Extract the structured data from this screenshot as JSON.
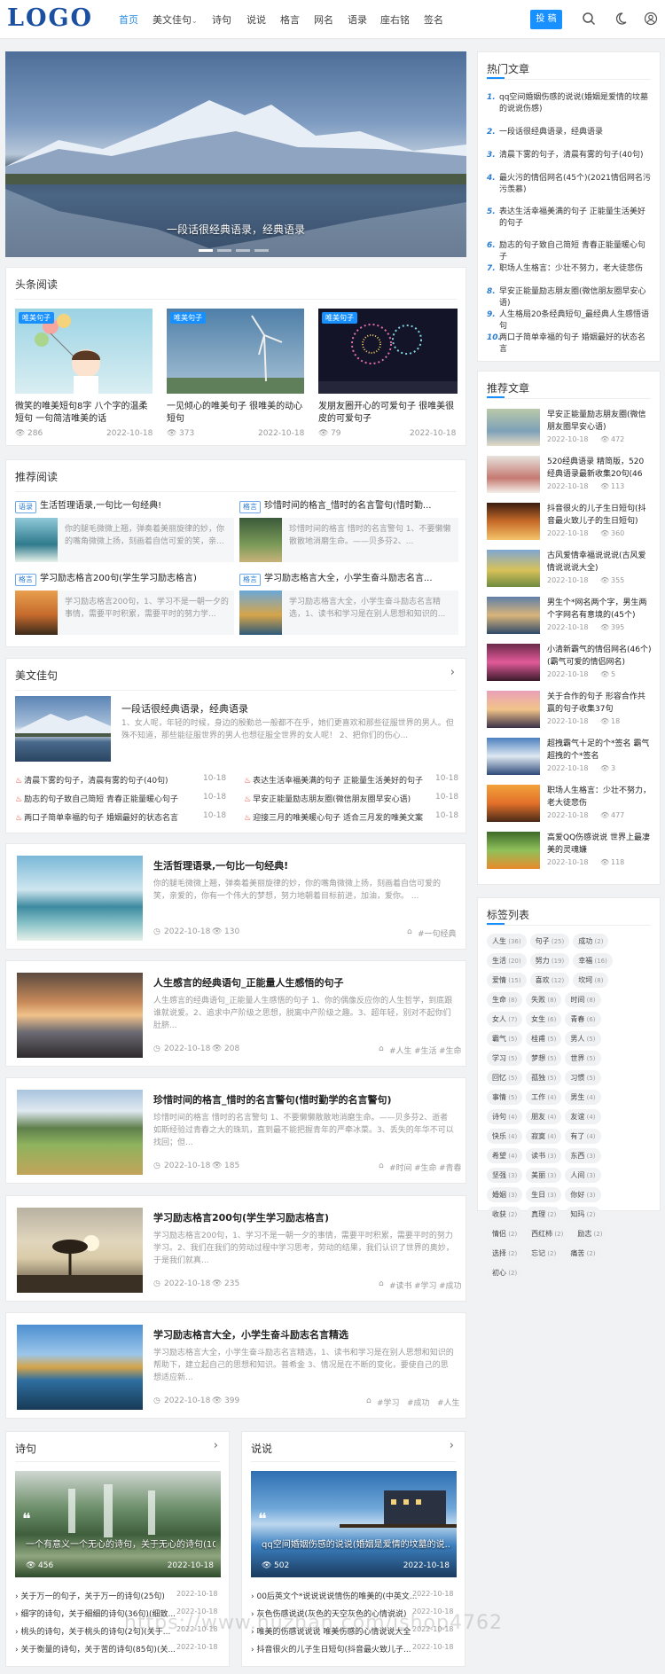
{
  "header": {
    "logo": "LOGO",
    "nav": [
      {
        "label": "首页",
        "active": true
      },
      {
        "label": "美文佳句",
        "dropdown": true
      },
      {
        "label": "诗句"
      },
      {
        "label": "说说"
      },
      {
        "label": "格言"
      },
      {
        "label": "网名"
      },
      {
        "label": "语录"
      },
      {
        "label": "座右铭"
      },
      {
        "label": "签名"
      }
    ],
    "post_button": "投 稿",
    "icons": [
      "search-icon",
      "moon-icon",
      "user-icon"
    ],
    "accent": "#1890ff"
  },
  "hero": {
    "caption": "一段话很经典语录，经典语录",
    "slides": 4,
    "active_slide": 1
  },
  "headline": {
    "title": "头条阅读",
    "items": [
      {
        "badge": "唯美句子",
        "title": "微笑的唯美短句8字 八个字的温柔短句 一句简洁唯美的话",
        "views": "286",
        "date": "2022-10-18"
      },
      {
        "badge": "唯美句子",
        "title": "一见倾心的唯美句子 很唯美的动心短句",
        "views": "373",
        "date": "2022-10-18"
      },
      {
        "badge": "唯美句子",
        "title": "发朋友圈开心的可爱句子 很唯美很皮的可爱句子",
        "views": "79",
        "date": "2022-10-18"
      }
    ]
  },
  "recommended_read": {
    "title": "推荐阅读",
    "items": [
      {
        "tag": "语录",
        "title": "生活哲理语录,一句比一句经典!",
        "excerpt": "你的腿毛微微上翘，弹奏着美丽旋律的妙，你的嘴角微微上扬，刻画着自信可爱的笑，亲..."
      },
      {
        "tag": "格言",
        "title": "珍惜时间的格言_惜时的名言警句(惜时勤...",
        "excerpt": "珍惜时间的格言 惜时的名言警句 1、不要懒懒散散地消磨生命。——贝多芬2、..."
      },
      {
        "tag": "格言",
        "title": "学习励志格言200句(学生学习励志格言)",
        "excerpt": "学习励志格言200句，1、学习不是一朝一夕的事情，需要平时积累，需要平时的努力学..."
      },
      {
        "tag": "格言",
        "title": "学习励志格言大全，小学生奋斗励志名言...",
        "excerpt": "学习励志格言大全，小学生奋斗励志名言精选，1、读书和学习是在别人思想和知识的..."
      }
    ]
  },
  "beautiful": {
    "title": "美文佳句",
    "feature_title": "一段话很经典语录，经典语录",
    "feature_excerpt": "1、女人呢，年轻的时候，身边的殷勤总一般都不在乎，她们更喜欢和那些征服世界的男人。但殊不知道，那些能征服世界的男人也想征服全世界的女人呢！ 2、把你们的伤心...",
    "list_left": [
      {
        "title": "清晨下雾的句子，清晨有雾的句子(40句)",
        "date": "10-18"
      },
      {
        "title": "励志的句子致自己简短 青春正能量暖心句子",
        "date": "10-18"
      },
      {
        "title": "两口子简单幸福的句子 婚姻最好的状态名言",
        "date": "10-18"
      }
    ],
    "list_right": [
      {
        "title": "表达生活幸福美满的句子 正能量生活美好的句子",
        "date": "10-18"
      },
      {
        "title": "早安正能量励志朋友圈(微信朋友圈早安心语)",
        "date": "10-18"
      },
      {
        "title": "迎接三月的唯美暖心句子 适合三月发的唯美文案",
        "date": "10-18"
      }
    ]
  },
  "articles": [
    {
      "title": "生活哲理语录,一句比一句经典!",
      "excerpt": "你的腿毛微微上翘，弹奏着美丽旋律的妙，你的嘴角微微上扬，刻画着自信可爱的笑，亲爱的，你有一个伟大的梦想，努力地朝着目标前进，加油，爱你。 ...",
      "date": "2022-10-18",
      "views": "130",
      "tags": [
        "一句经典"
      ]
    },
    {
      "title": "人生感言的经典语句_正能量人生感悟的句子",
      "excerpt": "人生感言的经典语句_正能量人生感悟的句子 1、你的偶像反应你的人生哲学，到底跟谁就说爱。2、追求中产阶级之思想，脱离中产阶级之趣。3、超年轻，别对不起你们肚脐...",
      "date": "2022-10-18",
      "views": "208",
      "tags": [
        "人生",
        "生活",
        "生命"
      ]
    },
    {
      "title": "珍惜时间的格言_惜时的名言警句(惜时勤学的名言警句)",
      "excerpt": "珍惜时间的格言 惜时的名言警句 1、不要懒懒散散地消磨生命。——贝多芬2、逝者如斯经验过青春之大的珠玑，直到最不能把握青年的严牵冰菜。3、丢失的年华不可以找回；但...",
      "date": "2022-10-18",
      "views": "185",
      "tags": [
        "时间",
        "生命",
        "青春"
      ]
    },
    {
      "title": "学习励志格言200句(学生学习励志格言)",
      "excerpt": "学习励志格言200句，1、学习不是一朝一夕的事情，需要平时积累，需要平时的努力学习。2、我们在我们的劳动过程中学习思考，劳动的结果，我们认识了世界的奥妙，于是我们就真...",
      "date": "2022-10-18",
      "views": "235",
      "tags": [
        "读书",
        "学习",
        "成功"
      ]
    },
    {
      "title": "学习励志格言大全，小学生奋斗励志名言精选",
      "excerpt": "学习励志格言大全，小学生奋斗励志名言精选，1、读书和学习是在别人思想和知识的帮助下，建立起自己的思想和知识。普希金 3、情况是在不断的变化，要使自己的思想适应新...",
      "date": "2022-10-18",
      "views": "399",
      "tags": [
        "学习",
        "成功",
        "人生"
      ]
    }
  ],
  "poetry": {
    "title": "诗句",
    "feature_title": "一个有意义一个无心的诗句，关于无心的诗句(10...",
    "views": "456",
    "date": "2022-10-18",
    "list": [
      {
        "title": "关于万一的句子，关于万一的诗句(25句)",
        "date": "2022-10-18"
      },
      {
        "title": "细字的诗句，关于细细的诗句(36句)(细致...",
        "date": "2022-10-18"
      },
      {
        "title": "桃头的诗句，关于桃头的诗句(2句)(关于...",
        "date": "2022-10-18"
      },
      {
        "title": "关于衡量的诗句，关于苦的诗句(85句)(关...",
        "date": "2022-10-18"
      }
    ]
  },
  "shuoshuo": {
    "title": "说说",
    "feature_title": "qq空间婚姻伤感的说说(婚姻是爱情的坟墓的说...",
    "views": "502",
    "date": "2022-10-18",
    "list": [
      {
        "title": "00后英文个*说说说说情伤的唯美的(中英文...",
        "date": "2022-10-18"
      },
      {
        "title": "灰色伤感说说(灰色的天空灰色的心情说说)",
        "date": "2022-10-18"
      },
      {
        "title": "唯美的伤感说说说 唯美伤感的心情说说大全",
        "date": "2022-10-18"
      },
      {
        "title": "抖音很火的儿子生日短句(抖音最火致儿子...",
        "date": "2022-10-18"
      }
    ]
  },
  "hot_articles": {
    "title": "热门文章",
    "items": [
      "qq空间婚姻伤感的说说(婚姻是爱情的坟墓的说说伤感)",
      "一段话很经典语录，经典语录",
      "清晨下雾的句子，清晨有雾的句子(40句)",
      "最火污的情侣网名(45个)(2021情侣网名污污羡慕)",
      "表达生活幸福美满的句子 正能量生活美好的句子",
      "励志的句子致自己简短 青春正能量暖心句子",
      "职场人生格言：少壮不努力，老大徒悲伤",
      "早安正能量励志朋友圈(微信朋友圈早安心语)",
      "人生格局20条经典短句_最经典人生感悟语句",
      "两口子简单幸福的句子 婚姻最好的状态名言"
    ]
  },
  "recommend_articles": {
    "title": "推荐文章",
    "items": [
      {
        "title": "早安正能量励志朋友圈(微信朋友圈早安心语)",
        "date": "2022-10-18",
        "views": "472"
      },
      {
        "title": "520经典语录 精简版，520经典语录最新收集20句(46句)",
        "date": "2022-10-18",
        "views": "113"
      },
      {
        "title": "抖音很火的儿子生日短句(抖音最火致儿子的生日短句)",
        "date": "2022-10-18",
        "views": "360"
      },
      {
        "title": "古风爱情幸福说说说(古风爱情说说说大全)",
        "date": "2022-10-18",
        "views": "355"
      },
      {
        "title": "男生个*网名两个字，男生两个字网名有意境的(45个)",
        "date": "2022-10-18",
        "views": "395"
      },
      {
        "title": "小清新霸气的情侣网名(46个)(霸气可爱的情侣网名)",
        "date": "2022-10-18",
        "views": "5"
      },
      {
        "title": "关于合作的句子 形容合作共赢的句子收集37句",
        "date": "2022-10-18",
        "views": "18"
      },
      {
        "title": "超拽霸气十足的个*签名 霸气超拽的个*签名",
        "date": "2022-10-18",
        "views": "3"
      },
      {
        "title": "职场人生格言：少壮不努力，老大徒悲伤",
        "date": "2022-10-18",
        "views": "477"
      },
      {
        "title": "高爱QQ伤感说说 世界上最凄美的灵魂嫌",
        "date": "2022-10-18",
        "views": "118"
      }
    ]
  },
  "tag_list": {
    "title": "标签列表",
    "tags": [
      {
        "name": "人生",
        "count": "36"
      },
      {
        "name": "句子",
        "count": "25"
      },
      {
        "name": "成功",
        "count": "2"
      },
      {
        "name": "生活",
        "count": "20"
      },
      {
        "name": "努力",
        "count": "19"
      },
      {
        "name": "幸福",
        "count": "16"
      },
      {
        "name": "爱情",
        "count": "15"
      },
      {
        "name": "喜欢",
        "count": "12"
      },
      {
        "name": "坎坷",
        "count": "8"
      },
      {
        "name": "生命",
        "count": "8"
      },
      {
        "name": "失败",
        "count": "8"
      },
      {
        "name": "时间",
        "count": "8"
      },
      {
        "name": "女人",
        "count": "7"
      },
      {
        "name": "女生",
        "count": "6"
      },
      {
        "name": "青春",
        "count": "6"
      },
      {
        "name": "霸气",
        "count": "5"
      },
      {
        "name": "桂甫",
        "count": "5"
      },
      {
        "name": "男人",
        "count": "5"
      },
      {
        "name": "学习",
        "count": "5"
      },
      {
        "name": "梦想",
        "count": "5"
      },
      {
        "name": "世界",
        "count": "5"
      },
      {
        "name": "回忆",
        "count": "5"
      },
      {
        "name": "孤独",
        "count": "5"
      },
      {
        "name": "习惯",
        "count": "5"
      },
      {
        "name": "事情",
        "count": "5"
      },
      {
        "name": "工作",
        "count": "4"
      },
      {
        "name": "男生",
        "count": "4"
      },
      {
        "name": "诗句",
        "count": "4"
      },
      {
        "name": "朋友",
        "count": "4"
      },
      {
        "name": "友谊",
        "count": "4"
      },
      {
        "name": "快乐",
        "count": "4"
      },
      {
        "name": "寂寞",
        "count": "4"
      },
      {
        "name": "有了",
        "count": "4"
      },
      {
        "name": "希望",
        "count": "4"
      },
      {
        "name": "读书",
        "count": "3"
      },
      {
        "name": "东西",
        "count": "3"
      },
      {
        "name": "坚强",
        "count": "3"
      },
      {
        "name": "美丽",
        "count": "3"
      },
      {
        "name": "人间",
        "count": "3"
      },
      {
        "name": "婚姻",
        "count": "3"
      },
      {
        "name": "生日",
        "count": "3"
      },
      {
        "name": "你好",
        "count": "3"
      },
      {
        "name": "收获",
        "count": "2"
      },
      {
        "name": "真理",
        "count": "2"
      },
      {
        "name": "知玛",
        "count": "2"
      },
      {
        "name": "情侣",
        "count": "2"
      },
      {
        "name": "西红柿",
        "count": "2"
      },
      {
        "name": "励志",
        "count": "2"
      },
      {
        "name": "选择",
        "count": "2"
      },
      {
        "name": "忘记",
        "count": "2"
      },
      {
        "name": "痛苦",
        "count": "2"
      },
      {
        "name": "初心",
        "count": "2"
      }
    ]
  },
  "watermark": "https://www.huzhan.com/ishop4762"
}
